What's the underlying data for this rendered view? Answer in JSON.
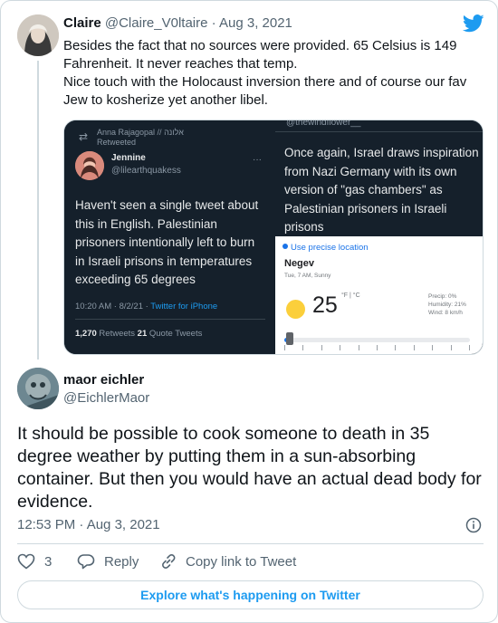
{
  "parent_tweet": {
    "display_name": "Claire",
    "handle": "@Claire_V0ltaire",
    "separator": " · ",
    "date": "Aug 3, 2021",
    "text": "Besides the fact that no sources were provided. 65 Celsius is 149 Fahrenheit. It never reaches that temp.\nNice touch with the Holocaust inversion there and of course our fav Jew to kosherize yet another libel."
  },
  "media_left": {
    "retweeted_by": "Anna Rajagopal // אלונה",
    "retweeted_label": "Retweeted",
    "author_name": "Jennine",
    "author_handle": "@lilearthquakess",
    "more": "···",
    "text": "Haven't seen a single tweet about this in English. Palestinian prisoners intentionally left to burn in Israeli prisons in temperatures exceeding 65 degrees",
    "time": "10:20 AM · 8/2/21 · ",
    "client": "Twitter for iPhone",
    "retweets_count": "1,270",
    "retweets_label": " Retweets  ",
    "quotes_count": "21",
    "quotes_label": " Quote Tweets"
  },
  "media_right": {
    "handle": "@thewindflower__",
    "text": "Once again, Israel draws inspiration from Nazi Germany with its own version of \"gas chambers\" as Palestinian prisoners in Israeli prisons",
    "weather": {
      "location_link": "Use precise location",
      "place": "Negev",
      "subtitle": "Tue, 7 AM, Sunny",
      "temperature": "25",
      "units": "°F | °C",
      "precip": "Precip: 0%",
      "humidity": "Humidity: 21%",
      "wind": "Wind: 8 km/h",
      "slider_position": 0.03
    }
  },
  "main_tweet": {
    "display_name": "maor eichler",
    "handle": "@EichlerMaor",
    "text": "It should be possible to cook someone to death in 35 degree weather by putting them in a sun-absorbing container. But then you would have an actual dead body for evidence.",
    "timestamp": "12:53 PM · Aug 3, 2021"
  },
  "actions": {
    "like_count": "3",
    "reply_label": "Reply",
    "copy_link_label": "Copy link to Tweet"
  },
  "explore_label": "Explore what's happening on Twitter",
  "colors": {
    "twitter_blue": "#1d9bf0",
    "dark_bg": "#15202b"
  }
}
